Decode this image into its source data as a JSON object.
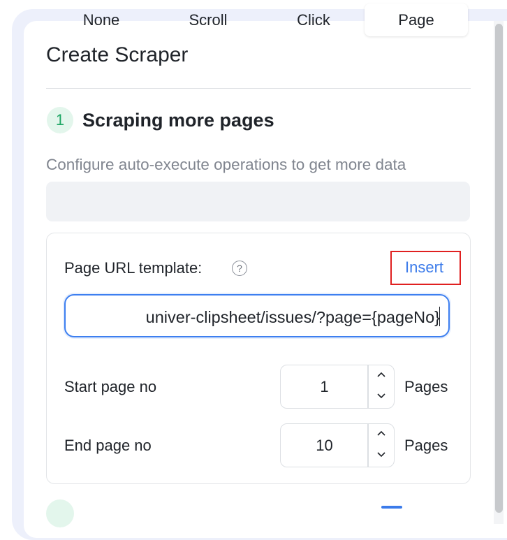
{
  "dialog": {
    "title": "Create Scraper"
  },
  "step": {
    "number": "1",
    "title": "Scraping more pages",
    "description": "Configure auto-execute operations to get more data"
  },
  "modes": {
    "options": [
      "None",
      "Scroll",
      "Click",
      "Page"
    ],
    "selected": "Page"
  },
  "page_config": {
    "url_label": "Page URL template:",
    "help_icon": "question-circle-icon",
    "insert_label": "Insert",
    "url_value": "univer-clipsheet/issues/?page={pageNo}",
    "start_label": "Start page no",
    "start_value": "1",
    "end_label": "End page no",
    "end_value": "10",
    "unit_label": "Pages"
  },
  "colors": {
    "accent": "#3b7bea",
    "step_badge_bg": "#e3f6ec",
    "step_badge_text": "#1fa765",
    "highlight_box": "#e02020"
  }
}
